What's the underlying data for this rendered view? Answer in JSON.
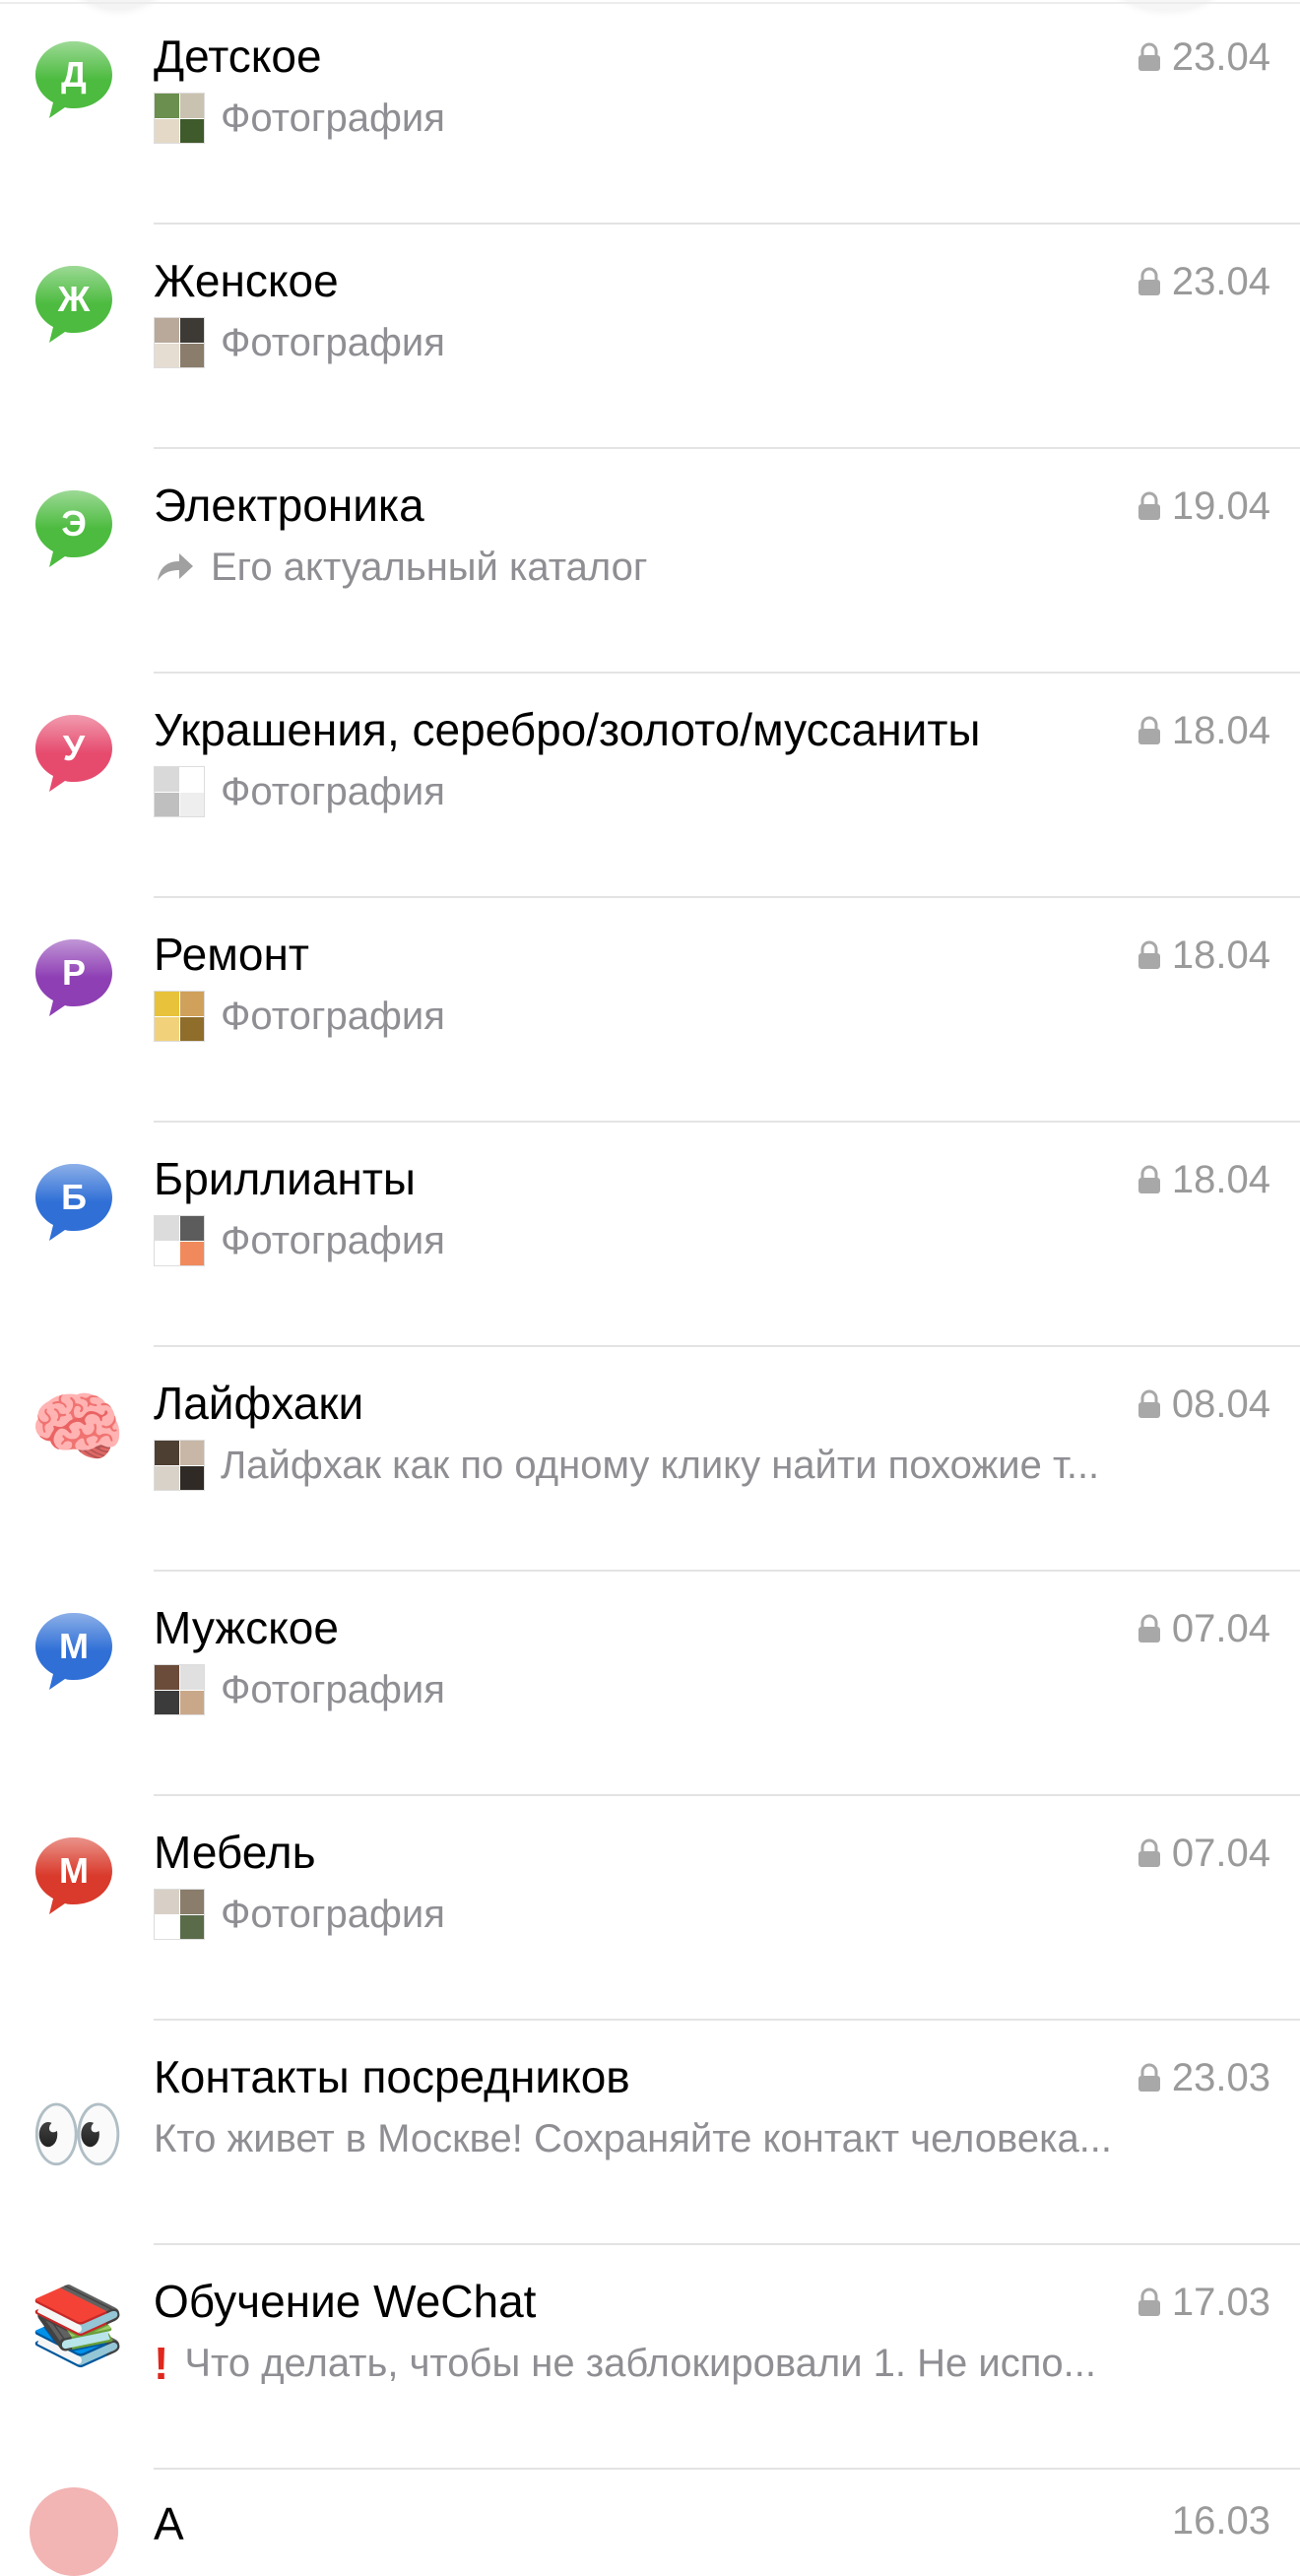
{
  "chats": [
    {
      "name": "Детское",
      "time": "23.04",
      "preview": "Фотография",
      "avatar": {
        "type": "bubble",
        "letter": "Д",
        "color": "#4cbb3f"
      },
      "attachment": "photo-thumb"
    },
    {
      "name": "Женское",
      "time": "23.04",
      "preview": "Фотография",
      "avatar": {
        "type": "bubble",
        "letter": "Ж",
        "color": "#4cbb3f"
      },
      "attachment": "photo-thumb"
    },
    {
      "name": "Электроника",
      "time": "19.04",
      "preview": "Его актуальный каталог",
      "avatar": {
        "type": "bubble",
        "letter": "Э",
        "color": "#4cbb3f"
      },
      "attachment": "forward-icon"
    },
    {
      "name": "Украшения, серебро/золото/муссаниты",
      "time": "18.04",
      "preview": "Фотография",
      "avatar": {
        "type": "bubble",
        "letter": "У",
        "color": "#e64b6e"
      },
      "attachment": "photo-thumb"
    },
    {
      "name": "Ремонт",
      "time": "18.04",
      "preview": "Фотография",
      "avatar": {
        "type": "bubble",
        "letter": "Р",
        "color": "#8e3fb4"
      },
      "attachment": "photo-thumb"
    },
    {
      "name": "Бриллианты",
      "time": "18.04",
      "preview": "Фотография",
      "avatar": {
        "type": "bubble",
        "letter": "Б",
        "color": "#2f6fd6"
      },
      "attachment": "photo-thumb"
    },
    {
      "name": "Лайфхаки",
      "time": "08.04",
      "preview": "Лайфхак как по одному клику найти похожие т...",
      "avatar": {
        "type": "emoji",
        "glyph": "🧠",
        "icon": "brain-icon"
      },
      "attachment": "photo-thumb"
    },
    {
      "name": "Мужское",
      "time": "07.04",
      "preview": "Фотография",
      "avatar": {
        "type": "bubble",
        "letter": "М",
        "color": "#2f6fd6"
      },
      "attachment": "photo-thumb"
    },
    {
      "name": "Мебель",
      "time": "07.04",
      "preview": "Фотография",
      "avatar": {
        "type": "bubble",
        "letter": "М",
        "color": "#d93a2b"
      },
      "attachment": "photo-thumb"
    },
    {
      "name": "Контакты посредников",
      "time": "23.03",
      "preview": "Кто живет в Москве! Сохраняйте контакт человека...",
      "avatar": {
        "type": "emoji",
        "glyph": "👀",
        "icon": "eyes-icon"
      },
      "attachment": "none"
    },
    {
      "name": "Обучение WeChat",
      "time": "17.03",
      "preview": "Что делать, чтобы не заблокировали 1. Не испо...",
      "avatar": {
        "type": "emoji",
        "glyph": "📚",
        "icon": "books-icon"
      },
      "attachment": "exclamation-icon"
    }
  ],
  "partial_row": {
    "name": "А",
    "time": "16.03"
  },
  "colors": {
    "title": "#000000",
    "secondary": "#8e8e93",
    "divider": "#e3e3e3"
  }
}
